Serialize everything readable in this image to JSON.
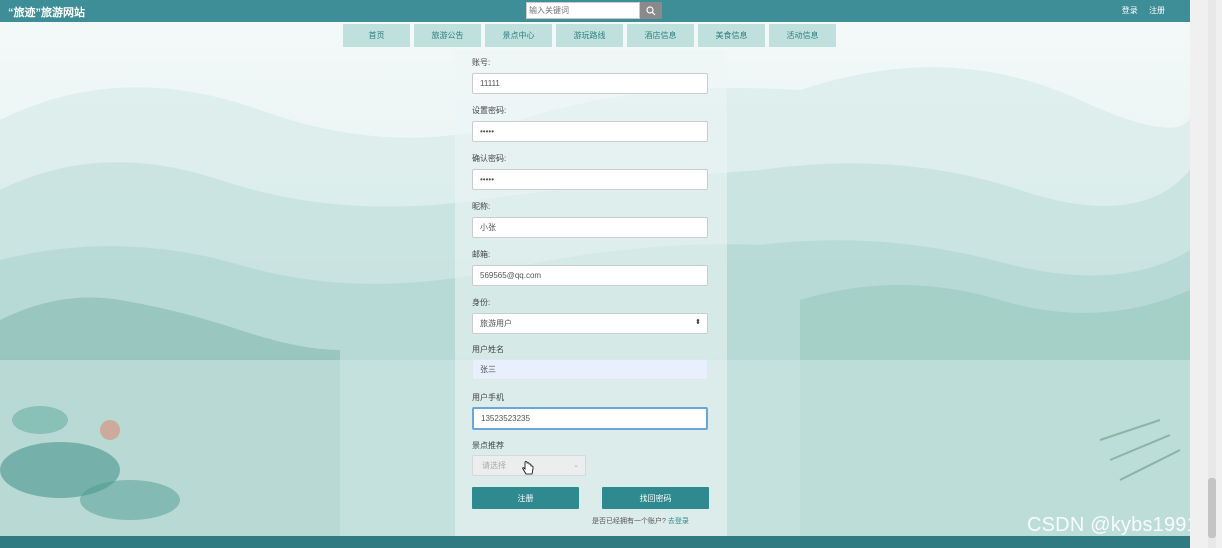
{
  "header": {
    "site_title": "“旅迹”旅游网站",
    "search_placeholder": "输入关键词",
    "login": "登录",
    "register": "注册"
  },
  "nav": {
    "items": [
      "首页",
      "旅游公告",
      "景点中心",
      "游玩路线",
      "酒店信息",
      "美食信息",
      "活动信息"
    ]
  },
  "form": {
    "account_label": "账号:",
    "account_value": "11111",
    "password_label": "设置密码:",
    "password_value": "•••••",
    "confirm_label": "确认密码:",
    "confirm_value": "•••••",
    "nickname_label": "昵称:",
    "nickname_value": "小张",
    "email_label": "邮箱:",
    "email_value": "569565@qq.com",
    "role_label": "身份:",
    "role_value": "旅游用户",
    "realname_label": "用户姓名",
    "realname_value": "张三",
    "phone_label": "用户手机",
    "phone_value": "13523523235",
    "recommend_label": "景点推荐",
    "recommend_placeholder": "请选择",
    "register_button": "注册",
    "forgot_button": "找回密码",
    "have_account_text": "是否已经拥有一个账户?",
    "login_link": "去登录"
  },
  "watermark": "CSDN @kybs1991",
  "colors": {
    "topbar": "#3d8e96",
    "nav_bg": "#bfe0dc",
    "button": "#2e8a8e",
    "footer": "#2f7b81"
  }
}
